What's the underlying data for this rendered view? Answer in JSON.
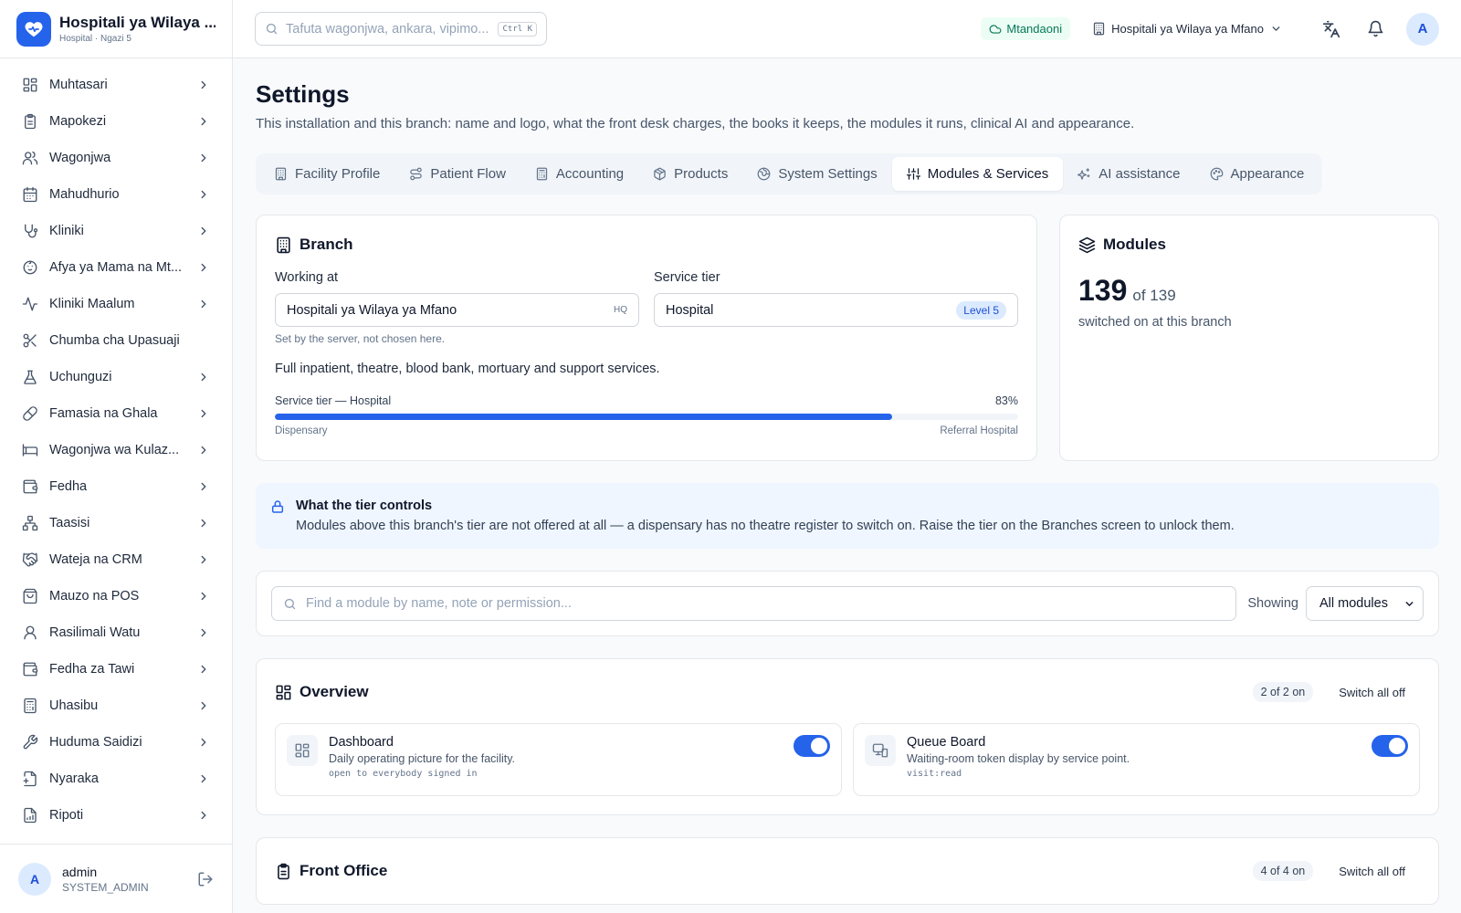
{
  "brand": {
    "name": "Hospitali ya Wilaya ...",
    "subtitle": "Hospital · Ngazi 5"
  },
  "sidebar": {
    "items": [
      {
        "label": "Muhtasari",
        "icon": "grid-icon",
        "chevron": true
      },
      {
        "label": "Mapokezi",
        "icon": "clipboard-icon",
        "chevron": true
      },
      {
        "label": "Wagonjwa",
        "icon": "users-icon",
        "chevron": true
      },
      {
        "label": "Mahudhurio",
        "icon": "calendar-icon",
        "chevron": true
      },
      {
        "label": "Kliniki",
        "icon": "stethoscope-icon",
        "chevron": true
      },
      {
        "label": "Afya ya Mama na Mt...",
        "icon": "baby-icon",
        "chevron": true
      },
      {
        "label": "Kliniki Maalum",
        "icon": "activity-icon",
        "chevron": true
      },
      {
        "label": "Chumba cha Upasuaji",
        "icon": "scissors-icon",
        "chevron": false
      },
      {
        "label": "Uchunguzi",
        "icon": "flask-icon",
        "chevron": true
      },
      {
        "label": "Famasia na Ghala",
        "icon": "pill-icon",
        "chevron": true
      },
      {
        "label": "Wagonjwa wa Kulaz...",
        "icon": "bed-icon",
        "chevron": true
      },
      {
        "label": "Fedha",
        "icon": "wallet-icon",
        "chevron": true
      },
      {
        "label": "Taasisi",
        "icon": "network-icon",
        "chevron": true
      },
      {
        "label": "Wateja na CRM",
        "icon": "handshake-icon",
        "chevron": true
      },
      {
        "label": "Mauzo na POS",
        "icon": "shopping-bag-icon",
        "chevron": true
      },
      {
        "label": "Rasilimali Watu",
        "icon": "user-icon",
        "chevron": true
      },
      {
        "label": "Fedha za Tawi",
        "icon": "wallet-icon",
        "chevron": true
      },
      {
        "label": "Uhasibu",
        "icon": "calculator-icon",
        "chevron": true
      },
      {
        "label": "Huduma Saidizi",
        "icon": "wrench-icon",
        "chevron": true
      },
      {
        "label": "Nyaraka",
        "icon": "file-icon",
        "chevron": true
      },
      {
        "label": "Ripoti",
        "icon": "report-icon",
        "chevron": true
      }
    ]
  },
  "user": {
    "initial": "A",
    "name": "admin",
    "role": "SYSTEM_ADMIN"
  },
  "header": {
    "search_placeholder": "Tafuta wagonjwa, ankara, vipimo...",
    "shortcut": "Ctrl K",
    "status": "Mtandaoni",
    "branch": "Hospitali ya Wilaya ya Mfano",
    "avatar": "A"
  },
  "page": {
    "title": "Settings",
    "description": "This installation and this branch: name and logo, what the front desk charges, the books it keeps, the modules it runs, clinical AI and appearance."
  },
  "tabs": [
    {
      "label": "Facility Profile",
      "icon": "building-icon",
      "active": false
    },
    {
      "label": "Patient Flow",
      "icon": "route-icon",
      "active": false
    },
    {
      "label": "Accounting",
      "icon": "calculator-icon",
      "active": false
    },
    {
      "label": "Products",
      "icon": "package-icon",
      "active": false
    },
    {
      "label": "System Settings",
      "icon": "globe-icon",
      "active": false
    },
    {
      "label": "Modules & Services",
      "icon": "sliders-icon",
      "active": true
    },
    {
      "label": "AI assistance",
      "icon": "sparkles-icon",
      "active": false
    },
    {
      "label": "Appearance",
      "icon": "palette-icon",
      "active": false
    }
  ],
  "branch_card": {
    "title": "Branch",
    "working_at_label": "Working at",
    "working_at_value": "Hospitali ya Wilaya ya Mfano",
    "working_at_tag": "HQ",
    "working_at_hint": "Set by the server, not chosen here.",
    "tier_label": "Service tier",
    "tier_value": "Hospital",
    "tier_badge": "Level 5",
    "tier_description": "Full inpatient, theatre, blood bank, mortuary and support services.",
    "progress_label": "Service tier — Hospital",
    "progress_percent_text": "83%",
    "progress_value": 0.83,
    "min_label": "Dispensary",
    "max_label": "Referral Hospital"
  },
  "modules_card": {
    "title": "Modules",
    "count": "139",
    "of_total": "of 139",
    "subtitle": "switched on at this branch"
  },
  "info": {
    "title": "What the tier controls",
    "text": "Modules above this branch's tier are not offered at all — a dispensary has no theatre register to switch on. Raise the tier on the Branches screen to unlock them."
  },
  "filter": {
    "placeholder": "Find a module by name, note or permission...",
    "showing_label": "Showing",
    "selected": "All modules"
  },
  "sections": [
    {
      "title": "Overview",
      "icon": "grid-icon",
      "count": "2 of 2 on",
      "action": "Switch all off",
      "modules": [
        {
          "name": "Dashboard",
          "desc": "Daily operating picture for the facility.",
          "perm": "open to everybody signed in",
          "icon": "grid-icon",
          "on": true
        },
        {
          "name": "Queue Board",
          "desc": "Waiting-room token display by service point.",
          "perm": "visit:read",
          "icon": "monitor-icon",
          "on": true
        }
      ]
    },
    {
      "title": "Front Office",
      "icon": "clipboard-icon",
      "count": "4 of 4 on",
      "action": "Switch all off"
    }
  ]
}
